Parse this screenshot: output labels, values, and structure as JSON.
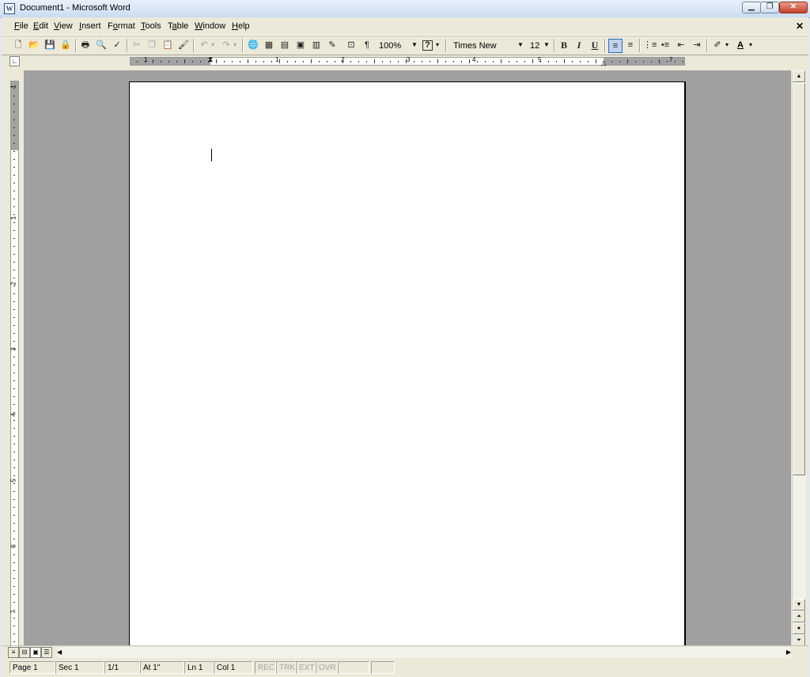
{
  "window": {
    "title": "Document1 - Microsoft Word",
    "app_icon": "W"
  },
  "menu": [
    {
      "label": "File",
      "key": "F",
      "rest": "ile"
    },
    {
      "label": "Edit",
      "key": "E",
      "rest": "dit"
    },
    {
      "label": "View",
      "key": "V",
      "rest": "iew"
    },
    {
      "label": "Insert",
      "key": "I",
      "rest": "nsert"
    },
    {
      "label": "Format",
      "key": "F",
      "pre": "",
      "rest": "ormat",
      "split": "o"
    },
    {
      "label": "Tools",
      "key": "T",
      "rest": "ools"
    },
    {
      "label": "Table",
      "key": "a",
      "pre": "T",
      "rest": "ble"
    },
    {
      "label": "Window",
      "key": "W",
      "rest": "indow"
    },
    {
      "label": "Help",
      "key": "H",
      "rest": "elp"
    }
  ],
  "toolbar": {
    "zoom": "100%",
    "font": "Times New Roma",
    "size": "12",
    "bold": "B",
    "italic": "I",
    "underline": "U",
    "pilcrow": "¶",
    "help": "?"
  },
  "ruler": {
    "ticks": [
      "1",
      "1",
      "2",
      "3",
      "4",
      "5",
      "7"
    ],
    "vticks": [
      "1",
      "1",
      "2",
      "3",
      "4",
      "5",
      "6",
      "7"
    ]
  },
  "status": {
    "page": "Page  1",
    "sec": "Sec  1",
    "pages": "1/1",
    "at": "At  1\"",
    "ln": "Ln  1",
    "col": "Col  1",
    "rec": "REC",
    "trk": "TRK",
    "ext": "EXT",
    "ovr": "OVR"
  }
}
